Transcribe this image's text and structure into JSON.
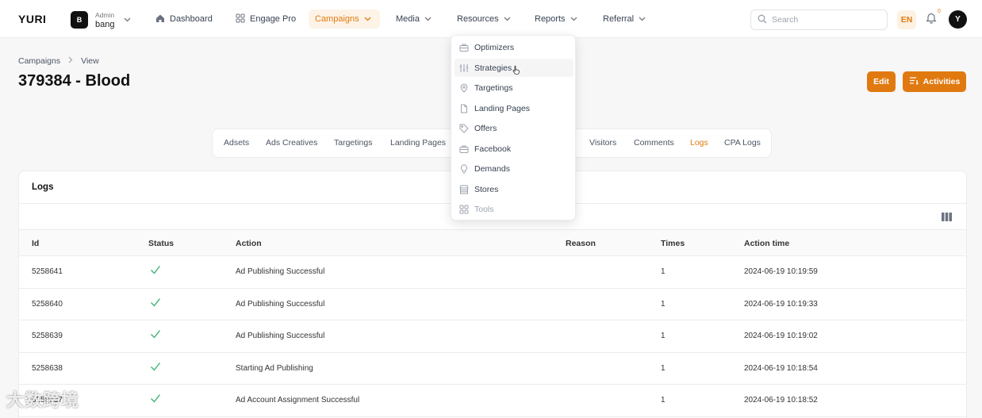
{
  "brand": {
    "logo": "YURI",
    "accent": "#e07a10"
  },
  "user_switch": {
    "avatar_letter": "B",
    "role": "Admin",
    "name": "bang"
  },
  "nav": {
    "dashboard": "Dashboard",
    "engage_pro": "Engage Pro",
    "campaigns": "Campaigns",
    "media": "Media",
    "resources": "Resources",
    "reports": "Reports",
    "referral": "Referral"
  },
  "search": {
    "placeholder": "Search"
  },
  "lang": "EN",
  "notifications": {
    "count": "0"
  },
  "me": {
    "avatar_letter": "Y"
  },
  "breadcrumb": {
    "root": "Campaigns",
    "current": "View"
  },
  "page": {
    "title": "379384 - Blood"
  },
  "actions": {
    "edit": "Edit",
    "activities": "Activities"
  },
  "tabs": {
    "adsets": "Adsets",
    "ads_creatives": "Ads Creatives",
    "targetings": "Targetings",
    "landing_pages": "Landing Pages",
    "visitors": "Visitors",
    "comments": "Comments",
    "logs": "Logs",
    "cpa_logs": "CPA Logs"
  },
  "resources_menu": [
    {
      "label": "Optimizers",
      "icon": "briefcase-icon"
    },
    {
      "label": "Strategies",
      "icon": "sliders-icon"
    },
    {
      "label": "Targetings",
      "icon": "location-pin-icon"
    },
    {
      "label": "Landing Pages",
      "icon": "file-icon"
    },
    {
      "label": "Offers",
      "icon": "tag-icon"
    },
    {
      "label": "Facebook",
      "icon": "briefcase-icon"
    },
    {
      "label": "Demands",
      "icon": "bulb-icon"
    },
    {
      "label": "Stores",
      "icon": "store-icon"
    },
    {
      "label": "Tools",
      "icon": "grid-icon"
    }
  ],
  "logs": {
    "title": "Logs",
    "columns": {
      "id": "Id",
      "status": "Status",
      "action": "Action",
      "reason": "Reason",
      "times": "Times",
      "action_time": "Action time"
    },
    "rows": [
      {
        "id": "5258641",
        "status": "success",
        "action": "Ad Publishing Successful",
        "reason": "",
        "times": "1",
        "action_time": "2024-06-19 10:19:59"
      },
      {
        "id": "5258640",
        "status": "success",
        "action": "Ad Publishing Successful",
        "reason": "",
        "times": "1",
        "action_time": "2024-06-19 10:19:33"
      },
      {
        "id": "5258639",
        "status": "success",
        "action": "Ad Publishing Successful",
        "reason": "",
        "times": "1",
        "action_time": "2024-06-19 10:19:02"
      },
      {
        "id": "5258638",
        "status": "success",
        "action": "Starting Ad Publishing",
        "reason": "",
        "times": "1",
        "action_time": "2024-06-19 10:18:54"
      },
      {
        "id": "5258637",
        "status": "success",
        "action": "Ad Account Assignment Successful",
        "reason": "",
        "times": "1",
        "action_time": "2024-06-19 10:18:52"
      }
    ]
  },
  "watermark": "大数跨境"
}
